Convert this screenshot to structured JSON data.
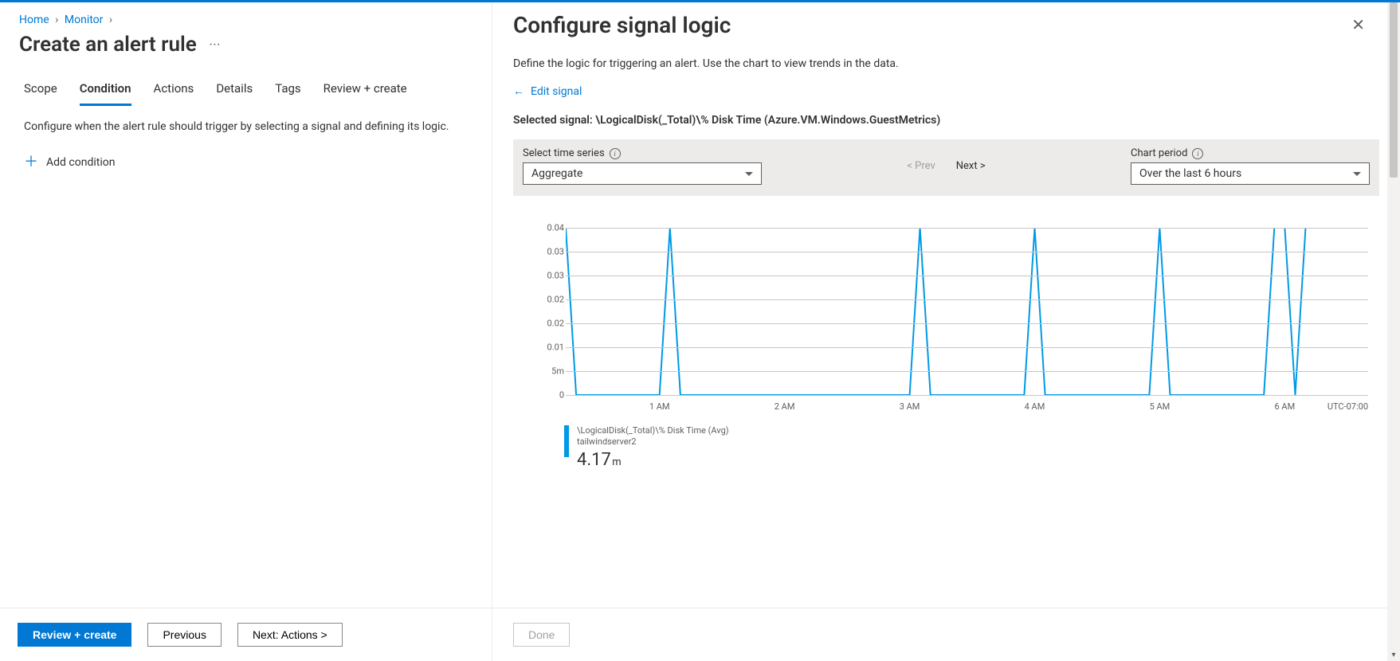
{
  "breadcrumbs": {
    "home": "Home",
    "monitor": "Monitor"
  },
  "page_title": "Create an alert rule",
  "ellipsis": "···",
  "tabs": {
    "scope": "Scope",
    "condition": "Condition",
    "actions": "Actions",
    "details": "Details",
    "tags": "Tags",
    "review": "Review + create"
  },
  "help_text": "Configure when the alert rule should trigger by selecting a signal and defining its logic.",
  "add_condition": "Add condition",
  "footer_buttons": {
    "review": "Review + create",
    "previous": "Previous",
    "next": "Next: Actions  >"
  },
  "panel": {
    "title": "Configure signal logic",
    "subtitle": "Define the logic for triggering an alert. Use the chart to view trends in the data.",
    "edit_signal": "Edit signal",
    "selected_signal_label": "Selected signal:",
    "selected_signal_value": "\\LogicalDisk(_Total)\\% Disk Time (Azure.VM.Windows.GuestMetrics)",
    "time_series_label": "Select time series",
    "time_series_value": "Aggregate",
    "prev": "< Prev",
    "next": "Next >",
    "chart_period_label": "Chart period",
    "chart_period_value": "Over the last 6 hours",
    "done": "Done"
  },
  "legend": {
    "series": "\\LogicalDisk(_Total)\\% Disk Time (Avg)",
    "resource": "tailwindserver2",
    "value": "4.17",
    "unit": "m"
  },
  "chart_data": {
    "type": "line",
    "ylabel": "",
    "xlabel": "",
    "ylim": [
      0,
      0.04
    ],
    "y_ticks": [
      "0",
      "5m",
      "0.01",
      "0.02",
      "0.02",
      "0.03",
      "0.03",
      "0.04"
    ],
    "x_ticks": [
      "1 AM",
      "2 AM",
      "3 AM",
      "4 AM",
      "5 AM",
      "6 AM"
    ],
    "tz": "UTC-07:00",
    "series": [
      {
        "name": "\\LogicalDisk(_Total)\\% Disk Time (Avg)",
        "color": "#0099e5",
        "x_start_minutes": 15,
        "x_end_minutes": 400,
        "x": [
          15,
          20,
          25,
          30,
          35,
          40,
          45,
          50,
          55,
          60,
          65,
          70,
          75,
          80,
          85,
          90,
          95,
          100,
          105,
          110,
          115,
          120,
          125,
          130,
          135,
          140,
          145,
          150,
          155,
          160,
          165,
          170,
          175,
          180,
          185,
          190,
          195,
          200,
          205,
          210,
          215,
          220,
          225,
          230,
          235,
          240,
          245,
          250,
          255,
          260,
          265,
          270,
          275,
          280,
          285,
          290,
          295,
          300,
          305,
          310,
          315,
          320,
          325,
          330,
          335,
          340,
          345,
          350,
          355,
          360,
          365,
          370,
          375,
          380,
          385,
          390,
          395,
          400
        ],
        "y": [
          0.04,
          0,
          0,
          0,
          0,
          0,
          0,
          0,
          0,
          0,
          0.04,
          0,
          0,
          0,
          0,
          0,
          0,
          0,
          0,
          0,
          0,
          0,
          0,
          0,
          0,
          0,
          0,
          0,
          0,
          0,
          0,
          0,
          0,
          0,
          0.04,
          0,
          0,
          0,
          0,
          0,
          0,
          0,
          0,
          0,
          0,
          0.04,
          0,
          0,
          0,
          0,
          0,
          0,
          0,
          0,
          0,
          0,
          0,
          0.04,
          0,
          0,
          0,
          0,
          0,
          0,
          0,
          0,
          0,
          0,
          0.04,
          0.04,
          0,
          0.04,
          0.04,
          0.04,
          0.04,
          0.04,
          0.04,
          0.04
        ]
      }
    ]
  }
}
